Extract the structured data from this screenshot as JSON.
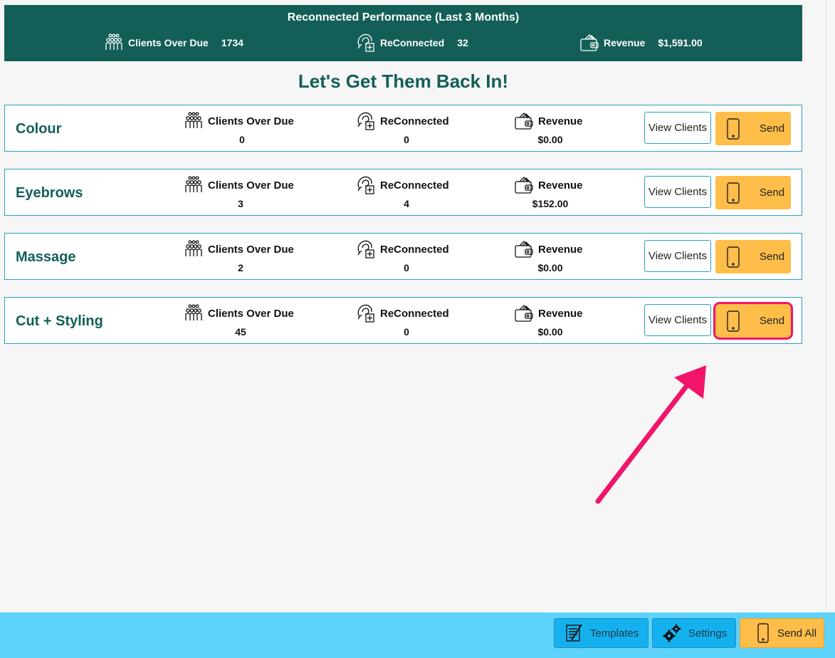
{
  "banner": {
    "title": "Reconnected Performance (Last 3 Months)",
    "stats": [
      {
        "label": "Clients Over Due",
        "value": "1734",
        "icon": "clients-icon"
      },
      {
        "label": "ReConnected",
        "value": "32",
        "icon": "reconnected-icon"
      },
      {
        "label": "Revenue",
        "value": "$1,591.00",
        "icon": "wallet-icon"
      }
    ]
  },
  "headline": "Let's Get Them Back In!",
  "stat_labels": {
    "clients_over_due": "Clients Over Due",
    "reconnected": "ReConnected",
    "revenue": "Revenue"
  },
  "buttons": {
    "view_clients": "View Clients",
    "send": "Send"
  },
  "services": [
    {
      "name": "Colour",
      "clients_over_due": "0",
      "reconnected": "0",
      "revenue": "$0.00"
    },
    {
      "name": "Eyebrows",
      "clients_over_due": "3",
      "reconnected": "4",
      "revenue": "$152.00"
    },
    {
      "name": "Massage",
      "clients_over_due": "2",
      "reconnected": "0",
      "revenue": "$0.00"
    },
    {
      "name": "Cut + Styling",
      "clients_over_due": "45",
      "reconnected": "0",
      "revenue": "$0.00"
    }
  ],
  "footer": {
    "templates": "Templates",
    "settings": "Settings",
    "send_all": "Send All"
  },
  "colors": {
    "banner": "#135f57",
    "send_button": "#ffbd4a",
    "footer": "#5dd2fa",
    "highlight": "#f0156a"
  }
}
